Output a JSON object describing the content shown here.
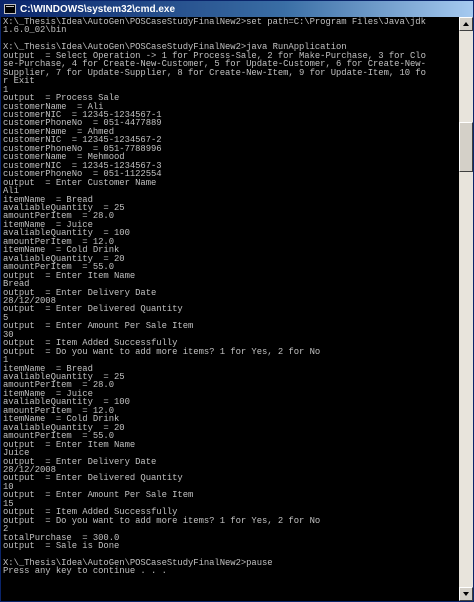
{
  "window": {
    "title": "C:\\WINDOWS\\system32\\cmd.exe",
    "icon": "cmd-icon"
  },
  "console": {
    "lines": [
      "X:\\_Thesis\\Idea\\AutoGen\\POSCaseStudyFinalNew2>set path=C:\\Program Files\\Java\\jdk",
      "1.6.0_02\\bin",
      "",
      "X:\\_Thesis\\Idea\\AutoGen\\POSCaseStudyFinalNew2>java RunApplication",
      "output  = Select Operation -> 1 for Process-Sale, 2 for Make-Purchase, 3 for Clo",
      "se-Purchase, 4 for Create-New-Customer, 5 for Update-Customer, 6 for Create-New-",
      "Supplier, 7 for Update-Supplier, 8 for Create-New-Item, 9 for Update-Item, 10 fo",
      "r Exit",
      "1",
      "output  = Process Sale",
      "customerName  = Ali",
      "customerNIC  = 12345-1234567-1",
      "customerPhoneNo  = 051-4477889",
      "customerName  = Ahmed",
      "customerNIC  = 12345-1234567-2",
      "customerPhoneNo  = 051-7788996",
      "customerName  = Mehmood",
      "customerNIC  = 12345-1234567-3",
      "customerPhoneNo  = 051-1122554",
      "output  = Enter Customer Name",
      "Ali",
      "itemName  = Bread",
      "avaliableQuantity  = 25",
      "amountPerItem  = 28.0",
      "itemName  = Juice",
      "avaliableQuantity  = 100",
      "amountPerItem  = 12.0",
      "itemName  = Cold Drink",
      "avaliableQuantity  = 20",
      "amountPerItem  = 55.0",
      "output  = Enter Item Name",
      "Bread",
      "output  = Enter Delivery Date",
      "28/12/2008",
      "output  = Enter Delivered Quantity",
      "5",
      "output  = Enter Amount Per Sale Item",
      "30",
      "output  = Item Added Successfully",
      "output  = Do you want to add more items? 1 for Yes, 2 for No",
      "1",
      "itemName  = Bread",
      "avaliableQuantity  = 25",
      "amountPerItem  = 28.0",
      "itemName  = Juice",
      "avaliableQuantity  = 100",
      "amountPerItem  = 12.0",
      "itemName  = Cold Drink",
      "avaliableQuantity  = 20",
      "amountPerItem  = 55.0",
      "output  = Enter Item Name",
      "Juice",
      "output  = Enter Delivery Date",
      "28/12/2008",
      "output  = Enter Delivered Quantity",
      "10",
      "output  = Enter Amount Per Sale Item",
      "15",
      "output  = Item Added Successfully",
      "output  = Do you want to add more items? 1 for Yes, 2 for No",
      "2",
      "totalPurchase  = 300.0",
      "output  = Sale is Done",
      "",
      "X:\\_Thesis\\Idea\\AutoGen\\POSCaseStudyFinalNew2>pause",
      "Press any key to continue . . ."
    ]
  },
  "colors": {
    "background": "#000000",
    "text": "#c0c0c0",
    "titlebar": "#0a246a"
  }
}
